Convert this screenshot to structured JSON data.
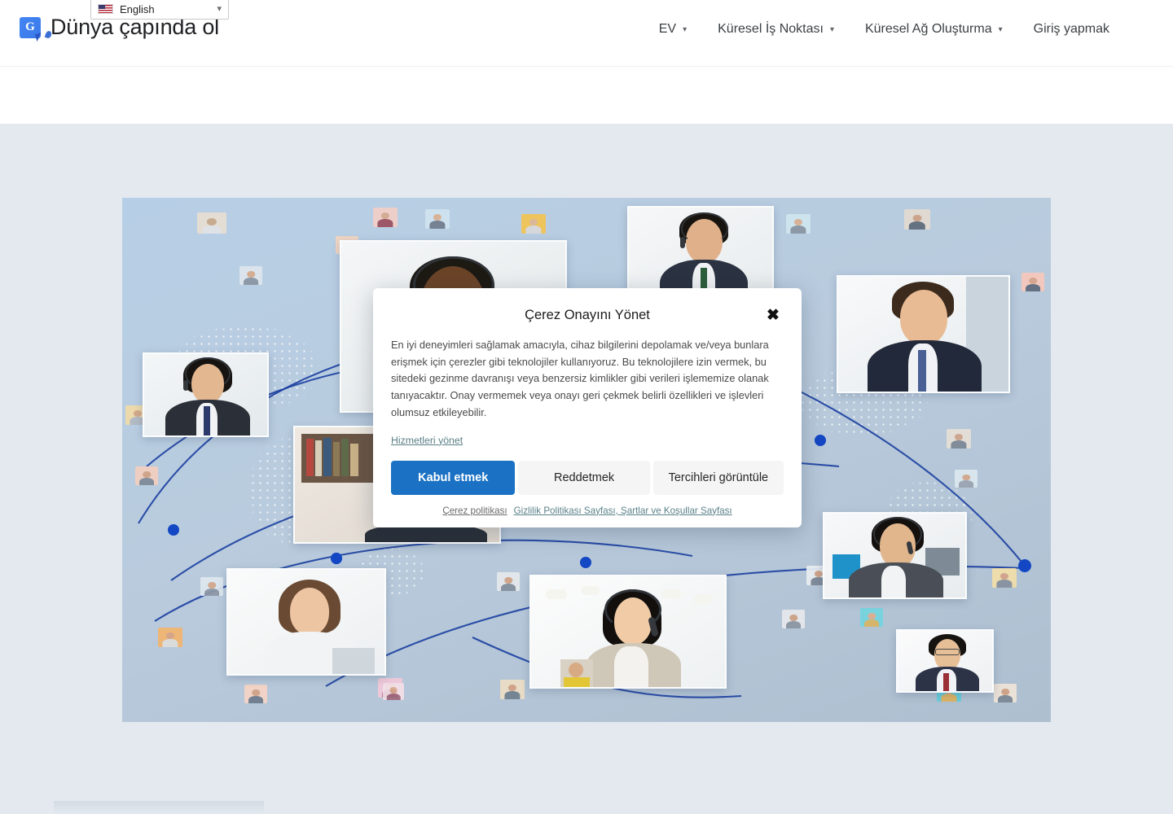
{
  "translate_bar": {
    "flag_icon": "us-flag-icon",
    "language": "English",
    "caret_icon": "chevron-down-icon"
  },
  "header": {
    "badge_icon": "google-translate-badge-icon",
    "badge_letter": "G",
    "title": "Dünya çapında ol",
    "nav": [
      {
        "label": "EV",
        "has_caret": true,
        "caret_icon": "chevron-down-icon"
      },
      {
        "label": "Küresel İş Noktası",
        "has_caret": true,
        "caret_icon": "chevron-down-icon"
      },
      {
        "label": "Küresel Ağ Oluşturma",
        "has_caret": true,
        "caret_icon": "chevron-down-icon"
      },
      {
        "label": "Giriş yapmak",
        "has_caret": false,
        "caret_icon": ""
      }
    ]
  },
  "hero": {
    "alt": "global-video-conference-hero-image",
    "background_color": "#b7cfe6",
    "map_style": "dotted-world-map",
    "arc_color": "#1b3fa0"
  },
  "cookie_dialog": {
    "title": "Çerez Onayını Yönet",
    "close_icon": "close-icon",
    "body": "En iyi deneyimleri sağlamak amacıyla, cihaz bilgilerini depolamak ve/veya bunlara erişmek için çerezler gibi teknolojiler kullanıyoruz. Bu teknolojilere izin vermek, bu sitedeki gezinme davranışı veya benzersiz kimlikler gibi verileri işlememize olanak tanıyacaktır. Onay vermemek veya onayı geri çekmek belirli özellikleri ve işlevleri olumsuz etkileyebilir.",
    "manage_services_label": "Hizmetleri yönet",
    "accept_label": "Kabul etmek",
    "reject_label": "Reddetmek",
    "preferences_label": "Tercihleri görüntüle",
    "cookie_policy_label": "Çerez politikası",
    "privacy_terms_label": "Gizlilik Politikası Sayfası, Şartlar ve Koşullar Sayfası",
    "accent_color": "#1b72c4"
  }
}
